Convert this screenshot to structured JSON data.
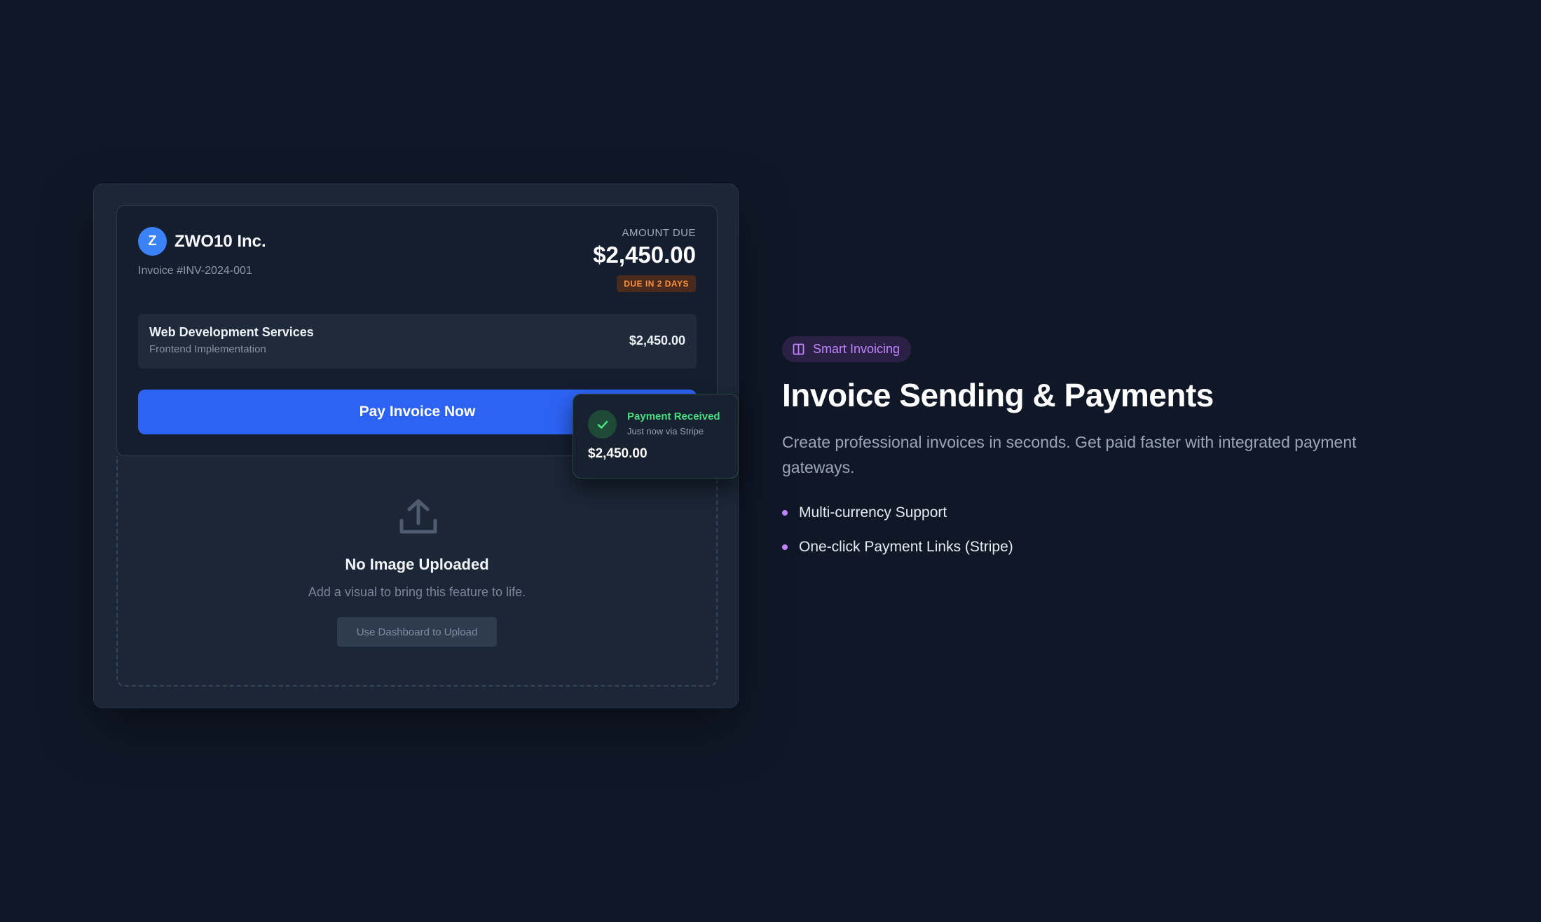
{
  "invoice": {
    "brand_initial": "Z",
    "company": "ZWO10 Inc.",
    "number": "Invoice #INV-2024-001",
    "amount_label": "AMOUNT DUE",
    "amount": "$2,450.00",
    "due_badge": "DUE IN 2 DAYS",
    "line_item": {
      "title": "Web Development Services",
      "subtitle": "Frontend Implementation",
      "price": "$2,450.00"
    },
    "pay_button": "Pay Invoice Now"
  },
  "upload": {
    "icon": "upload-icon",
    "title": "No Image Uploaded",
    "subtitle": "Add a visual to bring this feature to life.",
    "button": "Use Dashboard to Upload"
  },
  "toast": {
    "title": "Payment Received",
    "subtitle": "Just now via Stripe",
    "amount": "$2,450.00"
  },
  "feature": {
    "pill": "Smart Invoicing",
    "title": "Invoice Sending & Payments",
    "description": "Create professional invoices in seconds. Get paid faster with integrated payment gateways.",
    "items": [
      {
        "label": "Multi-currency Support"
      },
      {
        "label": "One-click Payment Links (Stripe)"
      }
    ]
  },
  "colors": {
    "background": "#101828",
    "accent_blue": "#2d63f5",
    "success_green": "#4ade80",
    "warning_orange": "#fb923c",
    "accent_purple": "#c084fc"
  }
}
